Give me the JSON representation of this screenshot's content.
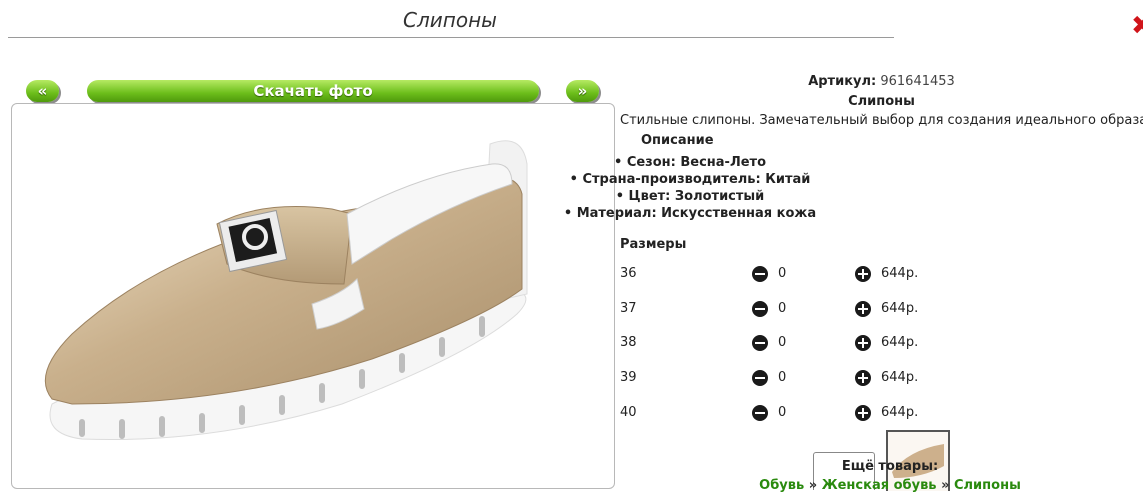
{
  "page": {
    "title": "Слипоны"
  },
  "nav": {
    "prev": "«",
    "download": "Скачать фото",
    "next": "»"
  },
  "product": {
    "article_label": "Артикул:",
    "article_value": "961641453",
    "name": "Слипоны",
    "description": "Стильные слипоны. Замечательный выбор для создания идеального образа",
    "desc_heading": "Описание",
    "features": [
      "Сезон: Весна-Лето",
      "Страна-производитель: Китай",
      "Цвет: Золотистый",
      "Материал: Искусственная кожа"
    ],
    "sizes_heading": "Размеры",
    "sizes": [
      {
        "size": "36",
        "qty": "0",
        "price": "644р."
      },
      {
        "size": "37",
        "qty": "0",
        "price": "644р."
      },
      {
        "size": "38",
        "qty": "0",
        "price": "644р."
      },
      {
        "size": "39",
        "qty": "0",
        "price": "644р."
      },
      {
        "size": "40",
        "qty": "0",
        "price": "644р."
      }
    ]
  },
  "more": {
    "title": "Ещё товары:",
    "crumbs": [
      "Обувь",
      "Женская обувь",
      "Слипоны"
    ],
    "separator": "»"
  },
  "colors": {
    "accent": "#6cbe1b",
    "link": "#2a8a0e",
    "close": "#d0141a"
  },
  "icons": {
    "minus": "minus-circle-icon",
    "plus": "plus-circle-icon",
    "close": "close-icon"
  }
}
